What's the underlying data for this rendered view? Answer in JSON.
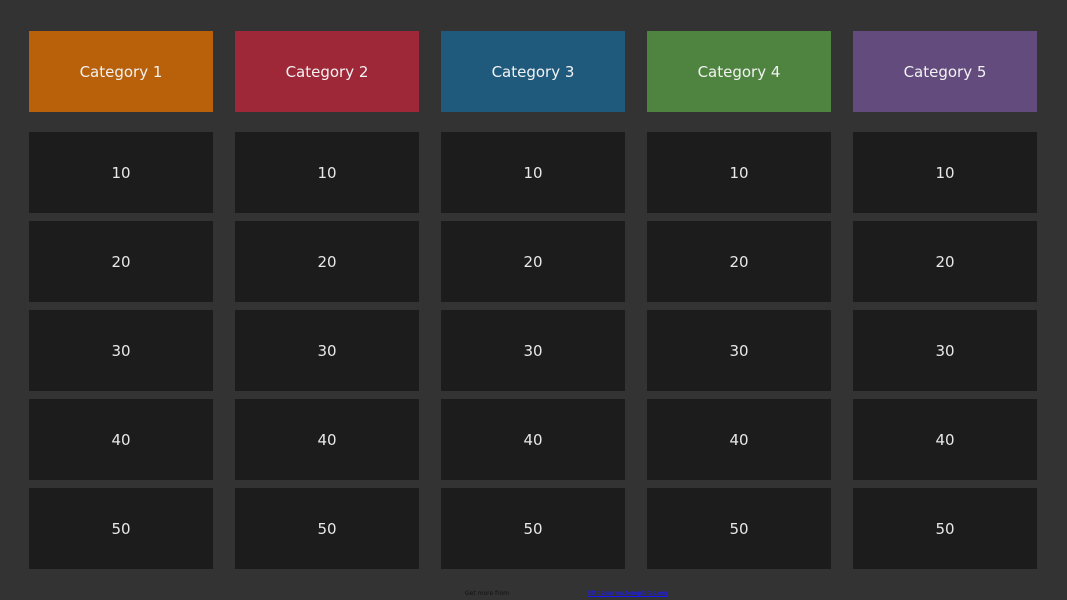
{
  "categories": [
    {
      "label": "Category 1",
      "color": "#b8610a"
    },
    {
      "label": "Category 2",
      "color": "#9e2838"
    },
    {
      "label": "Category 3",
      "color": "#1f5a7d"
    },
    {
      "label": "Category 4",
      "color": "#4f8440"
    },
    {
      "label": "Category 5",
      "color": "#634b7e"
    }
  ],
  "values": [
    "10",
    "20",
    "30",
    "40",
    "50"
  ],
  "footer": {
    "text": "Get more from",
    "link": "https://www.templates.org"
  }
}
